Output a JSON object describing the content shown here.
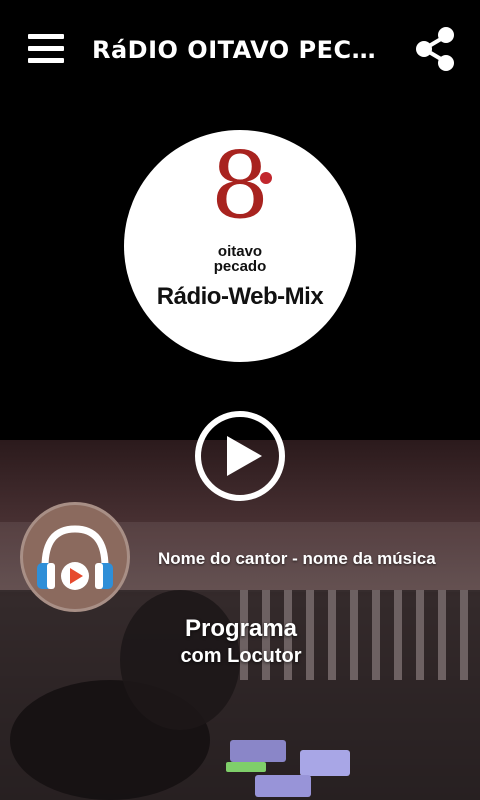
{
  "app": {
    "title": "RáDIO OITAVO PECADO RáDIO-WEB-MIX",
    "menu_icon": "hamburger-menu-icon",
    "share_icon": "share-icon"
  },
  "logo": {
    "numeral": "8",
    "line1": "oitavo",
    "line2": "pecado",
    "name": "Rádio-Web-Mix",
    "accent_color": "#a8231f"
  },
  "player": {
    "play_icon": "play-icon",
    "now_playing": "Nome do cantor - nome da música",
    "avatar_icon": "headphones-icon"
  },
  "program": {
    "title": "Programa",
    "host": "com Locutor"
  }
}
